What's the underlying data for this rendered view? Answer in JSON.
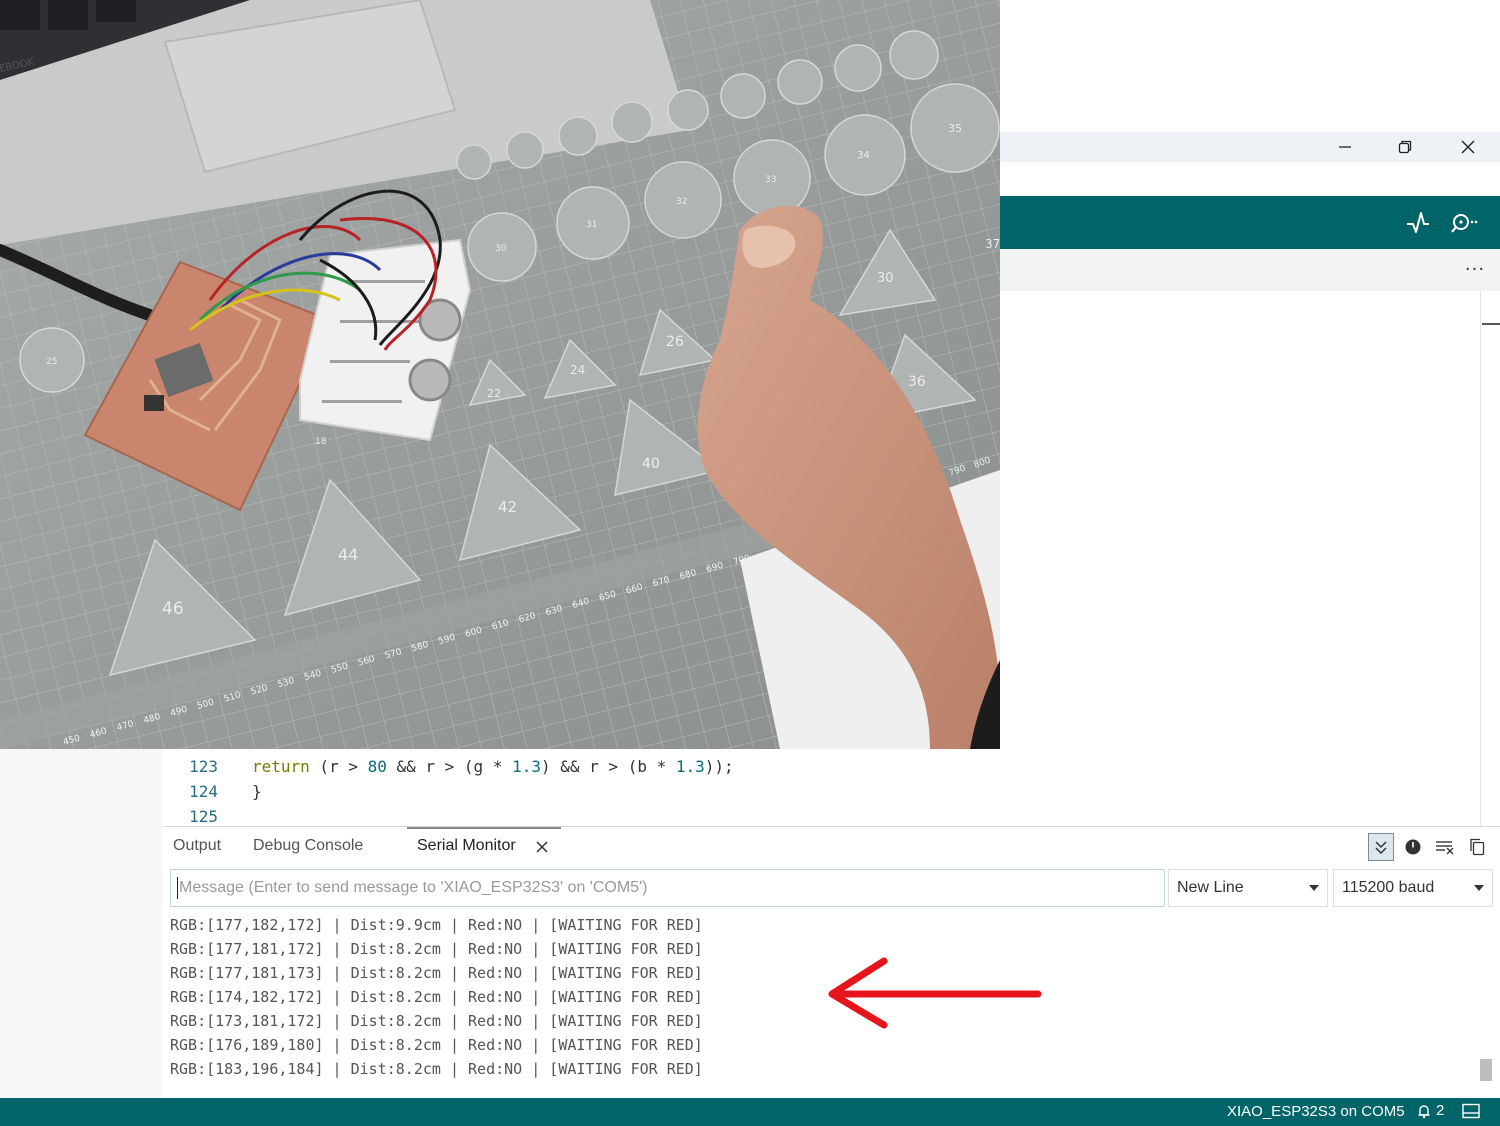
{
  "photo": {
    "laptop_brand_text": "EBOOK",
    "mat_numbers": [
      "25",
      "35",
      "30",
      "31",
      "32",
      "33",
      "34",
      "37",
      "30",
      "36",
      "26",
      "24",
      "22",
      "18",
      "40",
      "42",
      "44",
      "46",
      "790",
      "800"
    ],
    "ruler_numbers": [
      "450",
      "460",
      "470",
      "480",
      "490",
      "500",
      "510",
      "520",
      "530",
      "540",
      "550",
      "560",
      "570",
      "580",
      "590",
      "600",
      "610",
      "620",
      "630",
      "640",
      "650",
      "660",
      "670",
      "680",
      "690",
      "700"
    ]
  },
  "window": {
    "minimize_label": "—",
    "maximize_label": "❐",
    "close_label": "✕"
  },
  "toolbar": {
    "serial_plotter_icon": "pulse-icon",
    "serial_monitor_icon": "serial-monitor-icon"
  },
  "editor": {
    "more_label": "···",
    "lines": [
      {
        "number": "123",
        "parts": [
          {
            "t": "return",
            "c": "kw"
          },
          {
            "t": " (r > ",
            "c": ""
          },
          {
            "t": "80",
            "c": "num"
          },
          {
            "t": " && r > (g * ",
            "c": ""
          },
          {
            "t": "1.3",
            "c": "num"
          },
          {
            "t": ") && r > (b * ",
            "c": ""
          },
          {
            "t": "1.3",
            "c": "num"
          },
          {
            "t": "));",
            "c": ""
          }
        ]
      },
      {
        "number": "124",
        "parts": [
          {
            "t": "}",
            "c": ""
          }
        ]
      },
      {
        "number": "125",
        "parts": []
      }
    ]
  },
  "panel": {
    "tabs": {
      "output": "Output",
      "debug": "Debug Console",
      "serial": "Serial Monitor"
    },
    "message_placeholder": "Message (Enter to send message to 'XIAO_ESP32S3' on 'COM5')",
    "line_ending": "New Line",
    "baud_rate": "115200 baud",
    "log_lines": [
      "RGB:[177,182,172] | Dist:9.9cm | Red:NO | [WAITING FOR RED]",
      "RGB:[177,181,172] | Dist:8.2cm | Red:NO | [WAITING FOR RED]",
      "RGB:[177,181,173] | Dist:8.2cm | Red:NO | [WAITING FOR RED]",
      "RGB:[174,182,172] | Dist:8.2cm | Red:NO | [WAITING FOR RED]",
      "RGB:[173,181,172] | Dist:8.2cm | Red:NO | [WAITING FOR RED]",
      "RGB:[176,189,180] | Dist:8.2cm | Red:NO | [WAITING FOR RED]",
      "RGB:[183,196,184] | Dist:8.2cm | Red:NO | [WAITING FOR RED]"
    ]
  },
  "status": {
    "board": "XIAO_ESP32S3 on COM5",
    "notifications": "2"
  },
  "colors": {
    "accent": "#006468",
    "annotation_arrow": "#e8141c"
  }
}
